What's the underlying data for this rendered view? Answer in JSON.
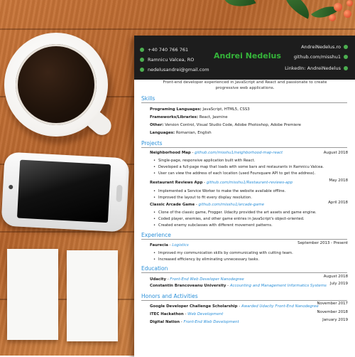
{
  "header": {
    "name_first": "Andrei",
    "name_last": "Nedelus",
    "phone": "+40 740 766 761",
    "location": "Ramnicu Valcea, RO",
    "email": "nedelusandrei@gmail.com",
    "website": "AndreiNedelus.ro",
    "github": "github.com/misshu1",
    "linkedin": "LinkedIn: AndreiNedelus"
  },
  "summary": "Front-end developer experienced in JavaScript and React and passionate to create progressive web applications.",
  "skills": {
    "title": "Skills",
    "items": [
      {
        "label": "Programing Languages:",
        "value": "JavaScript, HTML5, CSS3"
      },
      {
        "label": "Frameworks/Libraries:",
        "value": "React, Jasmine"
      },
      {
        "label": "Other:",
        "value": "Version Control, Visual Studio Code, Adobe Photoshop, Adobe Premiere"
      },
      {
        "label": "Languages:",
        "value": "Romanian, English"
      }
    ]
  },
  "projects": {
    "title": "Projects",
    "items": [
      {
        "name": "Neighborhood Map",
        "sep": " - ",
        "link": "github.com/misshu1/neighborhood-map-react",
        "date": "August 2018",
        "bullets": [
          "Single-page, responsive application built with React.",
          "Developed a full-page map that loads with some bars and restaurants in Ramnicu Valcea.",
          "User can view the address of each location (used Foursquare API to get the address)."
        ]
      },
      {
        "name": "Restaurant Reviews App",
        "sep": " - ",
        "link": "github.com/misshu1/Restaurant-reviews-app",
        "date": "May 2018",
        "bullets": [
          "Implemented a Service Worker to make the website available offline.",
          "Improved the layout to fit every display resolution."
        ]
      },
      {
        "name": "Classic Arcade Game",
        "sep": " - ",
        "link": "github.com/misshu1/arcade-game",
        "date": "April 2018",
        "bullets": [
          "Clone of the classic game, Frogger. Udacity provided the art assets and game engine.",
          "Coded player, enemies, and other game entries in JavaScript's object-oriented.",
          "Created enemy subclasses with different movement patterns."
        ]
      }
    ]
  },
  "experience": {
    "title": "Experience",
    "items": [
      {
        "name": "Faurecia",
        "sep": " - ",
        "link": "Logistics",
        "date": "September 2013 - Present",
        "bullets": [
          "Improved my communication skills by communicating with cutting team.",
          "Increased efficiency by eliminating unnecessary tasks."
        ]
      }
    ]
  },
  "education": {
    "title": "Education",
    "items": [
      {
        "name": "Udacity",
        "sep": " - ",
        "link": "Front-End Web Developer Nanodegree",
        "date": "August 2018"
      },
      {
        "name": "Constantin Brancoveanu University",
        "sep": " - ",
        "link": "Accounting and Management Informatics Systems",
        "date": "July 2019"
      }
    ]
  },
  "honors": {
    "title": "Honors and Activities",
    "items": [
      {
        "name": "Google Developer Challenge Scholarship",
        "sep": " - ",
        "link": "Awarded Udacity Front-End Nanodegree",
        "date": "November 2017"
      },
      {
        "name": "ITEC Hackathon",
        "sep": " - ",
        "link": "Web Development",
        "date": "November 2018"
      },
      {
        "name": "Digital Nation",
        "sep": " - ",
        "link": "Front-End Web Development",
        "date": "January 2019"
      }
    ]
  },
  "colors": {
    "accent": "#35b43a",
    "link": "#2a8fd8",
    "header_bg": "#1d1d1d",
    "desk": "#c9763a"
  }
}
